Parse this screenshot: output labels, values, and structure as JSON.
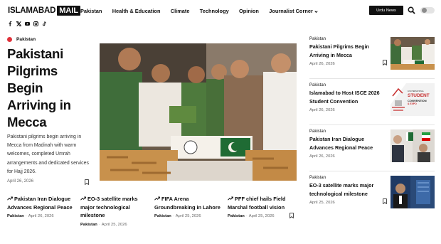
{
  "header": {
    "logo_main": "ISLAMABAD",
    "logo_box": "MAIL",
    "nav": [
      "Pakistan",
      "Health & Education",
      "Climate",
      "Technology",
      "Opinion",
      "Journalist Corner"
    ],
    "urdu_button": "Urdu News",
    "socials": [
      "facebook-icon",
      "x-icon",
      "youtube-icon",
      "instagram-icon",
      "tiktok-icon"
    ]
  },
  "hero": {
    "category": "Pakistan",
    "title": "Pakistani Pilgrims Begin Arriving in Mecca",
    "excerpt": "Pakistani pilgrims begin arriving in Mecca from Madinah with warm welcomes, completed Umrah arrangements and dedicated services for Hajj 2026.",
    "date": "April 26, 2026"
  },
  "bottom_items": [
    {
      "title": "Pakistan Iran Dialogue Advances Regional Peace",
      "category": "Pakistan",
      "date": "April 26, 2026"
    },
    {
      "title": "EO-3 satellite marks major technological milestone",
      "category": "Pakistan",
      "date": "April 25, 2026"
    },
    {
      "title": "FIFA Arena Groundbreaking in Lahore",
      "category": "Pakistan",
      "date": "April 25, 2026"
    },
    {
      "title": "PFF chief hails Field Marshal football vision",
      "category": "Pakistan",
      "date": "April 25, 2026"
    }
  ],
  "side_items": [
    {
      "category": "Pakistan",
      "title": "Pakistani Pilgrims Begin Arriving in Mecca",
      "date": "April 26, 2026"
    },
    {
      "category": "Pakistan",
      "title": "Islamabad to Host ISCE 2026 Student Convention",
      "date": "April 26, 2026",
      "thumb_text": [
        "4th INTERNATIONAL",
        "STUDENT",
        "CONVENTION",
        "& EXPO"
      ]
    },
    {
      "category": "Pakistan",
      "title": "Pakistan Iran Dialogue Advances Regional Peace",
      "date": "April 26, 2026"
    },
    {
      "category": "Pakistan",
      "title": "EO-3 satellite marks major technological milestone",
      "date": "April 25, 2026"
    }
  ],
  "colors": {
    "accent_red": "#e0323a",
    "text": "#111111",
    "muted": "#666666"
  }
}
